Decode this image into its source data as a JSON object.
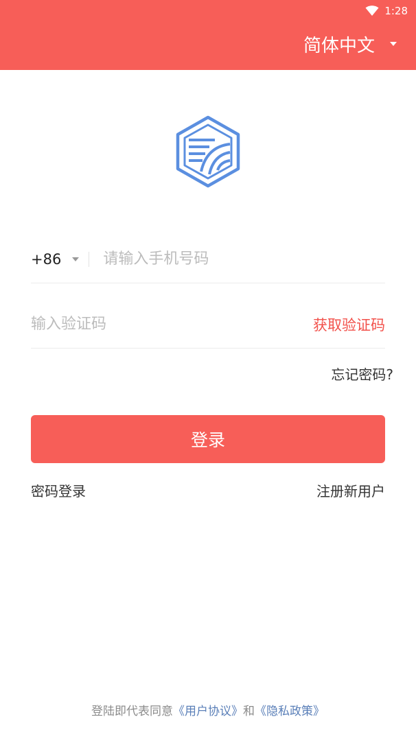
{
  "status_bar": {
    "time": "1:28",
    "wifi_icon": "wifi-icon"
  },
  "header": {
    "language": "简体中文"
  },
  "logo": {
    "icon": "app-logo-icon",
    "color": "#5b8fe0"
  },
  "form": {
    "country_code": "+86",
    "phone_placeholder": "请输入手机号码",
    "code_placeholder": "输入验证码",
    "get_code_label": "获取验证码",
    "forgot_label": "忘记密码?",
    "login_label": "登录",
    "password_login_label": "密码登录",
    "register_label": "注册新用户"
  },
  "agreement": {
    "prefix": "登陆即代表同意",
    "terms": "《用户协议》",
    "and": "和",
    "privacy": "《隐私政策》"
  },
  "colors": {
    "accent": "#f75e58",
    "link": "#5a7fb8"
  }
}
